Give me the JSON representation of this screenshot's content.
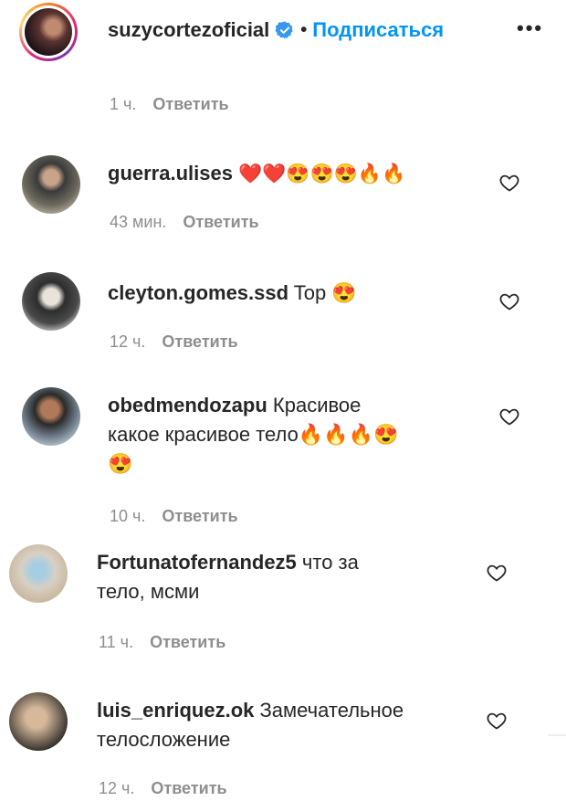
{
  "post": {
    "author": "suzycortezoficial",
    "separator": "•",
    "follow_label": "Подписаться",
    "more_label": "•••"
  },
  "top_meta": {
    "time": "1 ч.",
    "reply": "Ответить"
  },
  "comments": [
    {
      "user": "guerra.ulises",
      "text": "❤️❤️😍😍😍🔥🔥",
      "time": "43 мин.",
      "reply": "Ответить"
    },
    {
      "user": "cleyton.gomes.ssd",
      "text": "Top 😍",
      "time": "12 ч.",
      "reply": "Ответить"
    },
    {
      "user": "obedmendozapu",
      "text_line1": "Красивое",
      "text_line2": "какое красивое тело🔥🔥🔥😍",
      "text_line3": "😍",
      "time": "10 ч.",
      "reply": "Ответить"
    },
    {
      "user": "Fortunatofernandez5",
      "text_line1": "что за",
      "text_line2": "тело, мсми",
      "time": "11 ч.",
      "reply": "Ответить"
    },
    {
      "user": "luis_enriquez.ok",
      "text_line1": "Замечательное",
      "text_line2": "телосложение",
      "time": "12 ч.",
      "reply": "Ответить"
    }
  ],
  "colors": {
    "link": "#0095f6",
    "muted": "#8e8e8e",
    "text": "#262626",
    "verified": "#3897f0"
  }
}
